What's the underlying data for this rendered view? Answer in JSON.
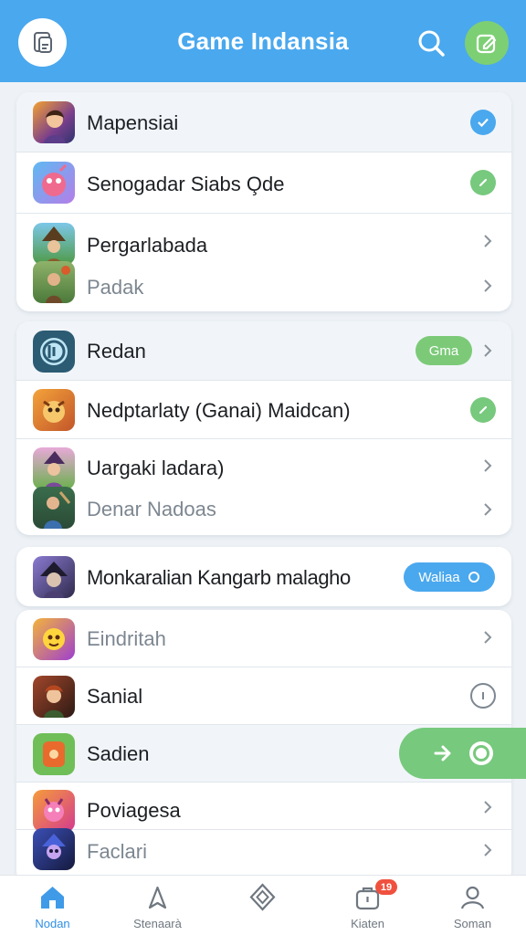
{
  "header": {
    "title": "Game Indansia",
    "logo_icon": "app-logo-icon",
    "search_icon": "search-icon",
    "edit_icon": "edit-icon",
    "accent": "#4aa8ee"
  },
  "groups": [
    {
      "items": [
        {
          "label": "Mapensiai",
          "trailing": "check-blue"
        },
        {
          "label": "Senogadar Siabs O̧de",
          "trailing": "check-green"
        },
        {
          "label": "Pergarlabada",
          "trailing": "chevron"
        },
        {
          "label": "Padak",
          "trailing": "chevron",
          "muted": true
        }
      ]
    },
    {
      "items": [
        {
          "label": "Redan",
          "trailing": "pill",
          "pill_label": "Gma"
        },
        {
          "label": "Nedptarlaty (Ganai) Maidcan)",
          "trailing": "check-green"
        },
        {
          "label": "Uargaki ladara)",
          "trailing": "chevron"
        },
        {
          "label": "Denar Nadoas",
          "trailing": "chevron",
          "muted": true
        }
      ]
    },
    {
      "items": [
        {
          "label": "Monkaralian Kangarb malagho",
          "trailing": "pill",
          "pill_label": "Waliaa"
        }
      ]
    },
    {
      "items": [
        {
          "label": "Eindritah",
          "trailing": "chevron",
          "muted": true
        },
        {
          "label": "Sanial",
          "trailing": "info"
        },
        {
          "label": "Sadien",
          "trailing": "action-toggle"
        },
        {
          "label": "Poviagesa",
          "trailing": "chevron"
        },
        {
          "label": "Faclari",
          "trailing": "chevron",
          "muted": true
        }
      ]
    }
  ],
  "tabbar": {
    "tabs": [
      {
        "label": "Nodan",
        "icon": "home-icon",
        "active": true
      },
      {
        "label": "Stenaarà",
        "icon": "bookmark-icon"
      },
      {
        "label": "",
        "icon": "diamond-icon"
      },
      {
        "label": "Kiaten",
        "icon": "bag-icon",
        "badge": "19"
      },
      {
        "label": "Soman",
        "icon": "profile-icon"
      }
    ]
  },
  "colors": {
    "blue": "#4aa8ee",
    "green": "#77c97d",
    "pill_green": "#7cca78",
    "badge_red": "#f0513f"
  }
}
